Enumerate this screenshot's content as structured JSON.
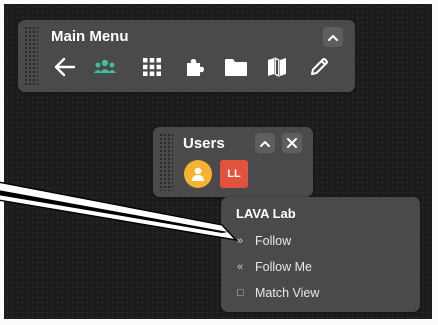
{
  "main_menu": {
    "title": "Main Menu",
    "collapse_icon": "chevron-up-icon",
    "tools": [
      {
        "name": "back-arrow-icon",
        "color": "#ffffff"
      },
      {
        "name": "users-icon",
        "color": "#3fbf9f"
      },
      {
        "name": "grid-icon",
        "color": "#ffffff"
      },
      {
        "name": "puzzle-icon",
        "color": "#ffffff"
      },
      {
        "name": "folder-icon",
        "color": "#ffffff"
      },
      {
        "name": "map-icon",
        "color": "#ffffff"
      },
      {
        "name": "pencil-icon",
        "color": "#ffffff"
      }
    ]
  },
  "users_panel": {
    "title": "Users",
    "collapse_icon": "chevron-up-icon",
    "close_icon": "close-icon",
    "users": [
      {
        "type": "icon",
        "icon": "person-icon",
        "color": "#f5b331"
      },
      {
        "type": "initials",
        "initials": "LL",
        "color": "#e2533d"
      }
    ]
  },
  "context_menu": {
    "heading": "LAVA Lab",
    "items": [
      {
        "icon": "»",
        "label": "Follow"
      },
      {
        "icon": "«",
        "label": "Follow Me"
      },
      {
        "icon": "□",
        "label": "Match View"
      }
    ]
  }
}
